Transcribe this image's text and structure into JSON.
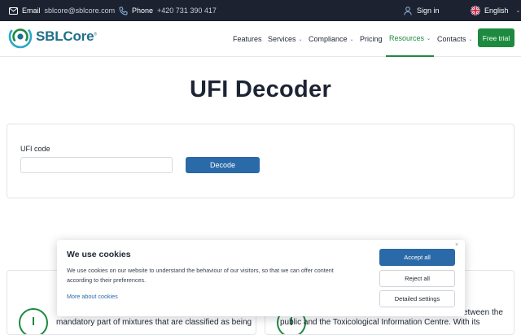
{
  "topbar": {
    "email_label": "Email",
    "email_value": "sblcore@sblcore.com",
    "phone_label": "Phone",
    "phone_value": "+420 731 390 417",
    "signin": "Sign in",
    "language": "English"
  },
  "brand": {
    "name": "SBLCore",
    "mark": "®"
  },
  "nav": {
    "items": [
      {
        "label": "Features"
      },
      {
        "label": "Services"
      },
      {
        "label": "Compliance"
      },
      {
        "label": "Pricing"
      },
      {
        "label": "Resources",
        "active": true
      },
      {
        "label": "Contacts"
      }
    ],
    "cta": "Free trial"
  },
  "page": {
    "title": "UFI Decoder"
  },
  "decoder": {
    "label": "UFI code",
    "input_value": "",
    "input_placeholder": "",
    "button": "Decode"
  },
  "info": {
    "left_line": "mandatory part of mixtures that are classified as being",
    "right_line_1": "etween the",
    "right_line_2": "public and the Toxicological Information Centre. With its"
  },
  "cookie": {
    "title": "We use cookies",
    "description": "We use cookies on our website to understand the behaviour of our visitors, so that we can offer content according to their preferences.",
    "link": "More about cookies",
    "accept": "Accept all",
    "reject": "Reject all",
    "settings": "Detailed settings",
    "close": "×"
  },
  "colors": {
    "topbar_bg": "#1c2230",
    "brand": "#1f6f8b",
    "accent_green": "#1d8a3f",
    "button_blue": "#2b6aa8"
  },
  "icons": [
    "mail-icon",
    "phone-icon",
    "user-icon",
    "uk-flag-icon",
    "chevron-down-icon",
    "logo-icon",
    "info-icon"
  ]
}
